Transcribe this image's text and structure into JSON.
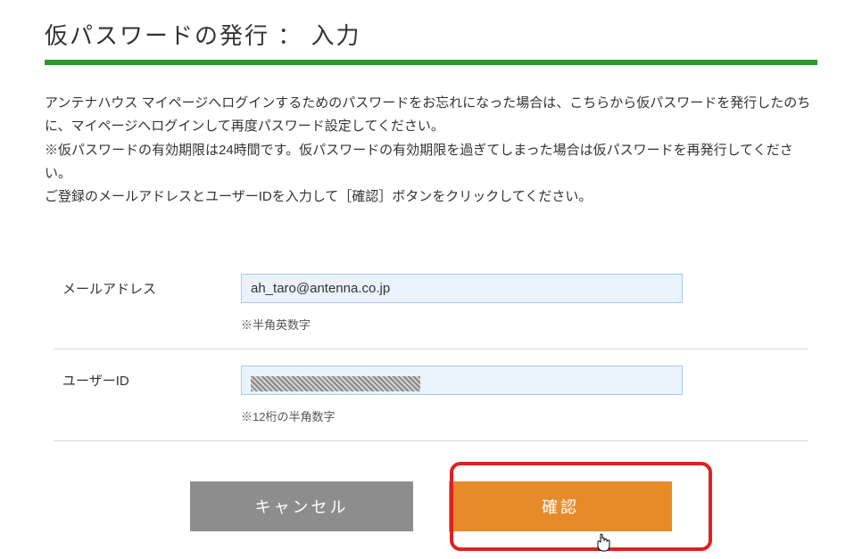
{
  "title": "仮パスワードの発行 ： 入力",
  "instructions": {
    "p1": "アンテナハウス マイページへログインするためのパスワードをお忘れになった場合は、こちらから仮パスワードを発行したのちに、マイページへログインして再度パスワード設定してください。",
    "p2": "※仮パスワードの有効期限は24時間です。仮パスワードの有効期限を過ぎてしまった場合は仮パスワードを再発行してください。",
    "p3": "ご登録のメールアドレスとユーザーIDを入力して［確認］ボタンをクリックしてください。"
  },
  "form": {
    "email": {
      "label": "メールアドレス",
      "value": "ah_taro@antenna.co.jp",
      "hint": "※半角英数字"
    },
    "userid": {
      "label": "ユーザーID",
      "hint": "※12桁の半角数字"
    }
  },
  "buttons": {
    "cancel": "キャンセル",
    "confirm": "確認"
  }
}
